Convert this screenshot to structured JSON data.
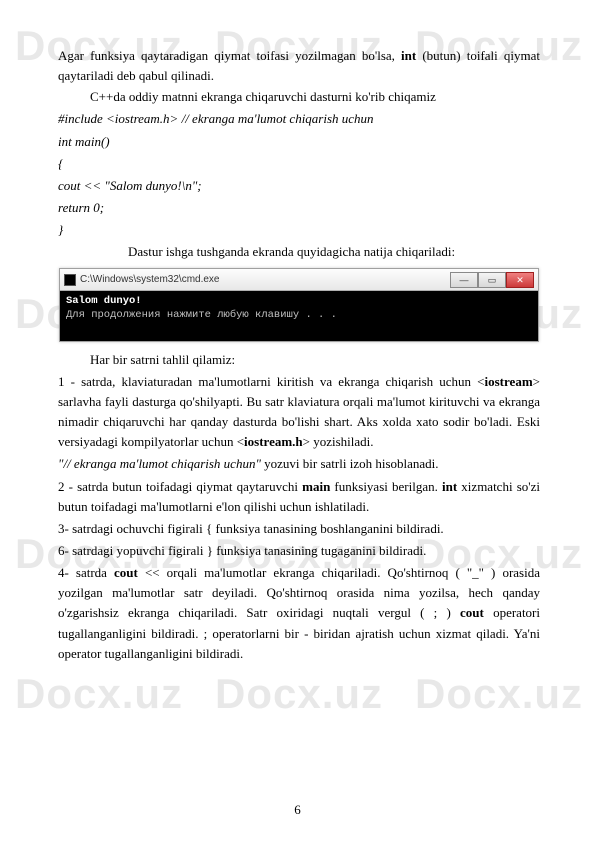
{
  "watermark": "Docx.uz",
  "paragraphs": {
    "p1a": "Agar funksiya qaytaradigan qiymat toifasi yozilmagan bo'lsa, ",
    "p1b": "int",
    "p1c": " (butun) toifali qiymat qaytariladi deb qabul qilinadi.",
    "p2": "C++da oddiy matnni ekranga chiqaruvchi dasturni ko'rib chiqamiz",
    "code1": "#include <iostream.h> // ekranga ma'lumot chiqarish uchun",
    "code2": "int main()",
    "code3": "{",
    "code4": "cout << \"Salom dunyo!\\n\";",
    "code5": "return 0;",
    "code6": "}",
    "p3": "Dastur ishga tushganda ekranda quyidagicha natija chiqariladi:",
    "p4": "Har bir satrni tahlil qilamiz:",
    "p5a": "1 - satrda, klaviaturadan ma'lumotlarni kiritish va ekranga chiqarish uchun <",
    "p5b": "iostream",
    "p5c": "> sarlavha fayli dasturga qo'shilyapti. Bu satr klaviatura orqali ma'lumot kirituvchi va ekranga nimadir chiqaruvchi har qanday dasturda bo'lishi shart. Aks xolda xato sodir bo'ladi. Eski versiyadagi kompilyatorlar uchun <",
    "p5d": "iostream.h",
    "p5e": "> yozishiladi.",
    "p6a": "\"// ekranga ma'lumot chiqarish uchun\"",
    "p6b": " yozuvi bir satrli izoh hisoblanadi.",
    "p7a": "2 - satrda butun toifadagi qiymat qaytaruvchi ",
    "p7b": "main",
    "p7c": " funksiyasi berilgan. ",
    "p7d": "int",
    "p7e": " xizmatchi so'zi butun toifadagi ma'lumotlarni e'lon qilishi uchun ishlatiladi.",
    "p8": "3- satrdagi ochuvchi figirali { funksiya tanasining boshlanganini bildiradi.",
    "p9": "6- satrdagi yopuvchi figirali } funksiya tanasining tugaganini bildiradi.",
    "p10a": "4- satrda ",
    "p10b": "cout",
    "p10c": " << orqali ma'lumotlar ekranga chiqariladi. Qo'shtirnoq ( \"_\" ) orasida yozilgan ma'lumotlar satr deyiladi. Qo'shtirnoq orasida nima yozilsa, hech qanday o'zgarishsiz ekranga chiqariladi. Satr oxiridagi nuqtali vergul ( ; ) ",
    "p10d": "cout",
    "p10e": " operatori tugallanganligini bildiradi. ; operatorlarni bir - biridan ajratish uchun xizmat qiladi. Ya'ni operator tugallanganligini bildiradi."
  },
  "console": {
    "title": "C:\\Windows\\system32\\cmd.exe",
    "line1": "Salom dunyo!",
    "line2": "Для продолжения нажмите любую клавишу . . ."
  },
  "buttons": {
    "min": "—",
    "max": "▭",
    "close": "✕"
  },
  "pageNumber": "6"
}
